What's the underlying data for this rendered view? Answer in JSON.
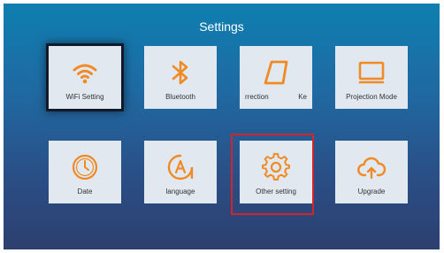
{
  "header": {
    "title": "Settings"
  },
  "tiles": [
    {
      "label": "WiFi Setting",
      "icon": "wifi-icon"
    },
    {
      "label": "Bluetooth",
      "icon": "bluetooth-icon"
    },
    {
      "label_a": "rrection",
      "label_b": "Ke",
      "icon": "keystone-icon"
    },
    {
      "label": "Projection Mode",
      "icon": "screen-icon"
    },
    {
      "label": "Date",
      "icon": "clock-icon"
    },
    {
      "label": "language",
      "icon": "language-icon"
    },
    {
      "label": "Other setting",
      "icon": "gear-icon"
    },
    {
      "label": "Upgrade",
      "icon": "cloud-upload-icon"
    }
  ],
  "colors": {
    "accent": "#f08a24",
    "highlight": "#d3232b",
    "tile_bg": "#e1e8f0"
  }
}
